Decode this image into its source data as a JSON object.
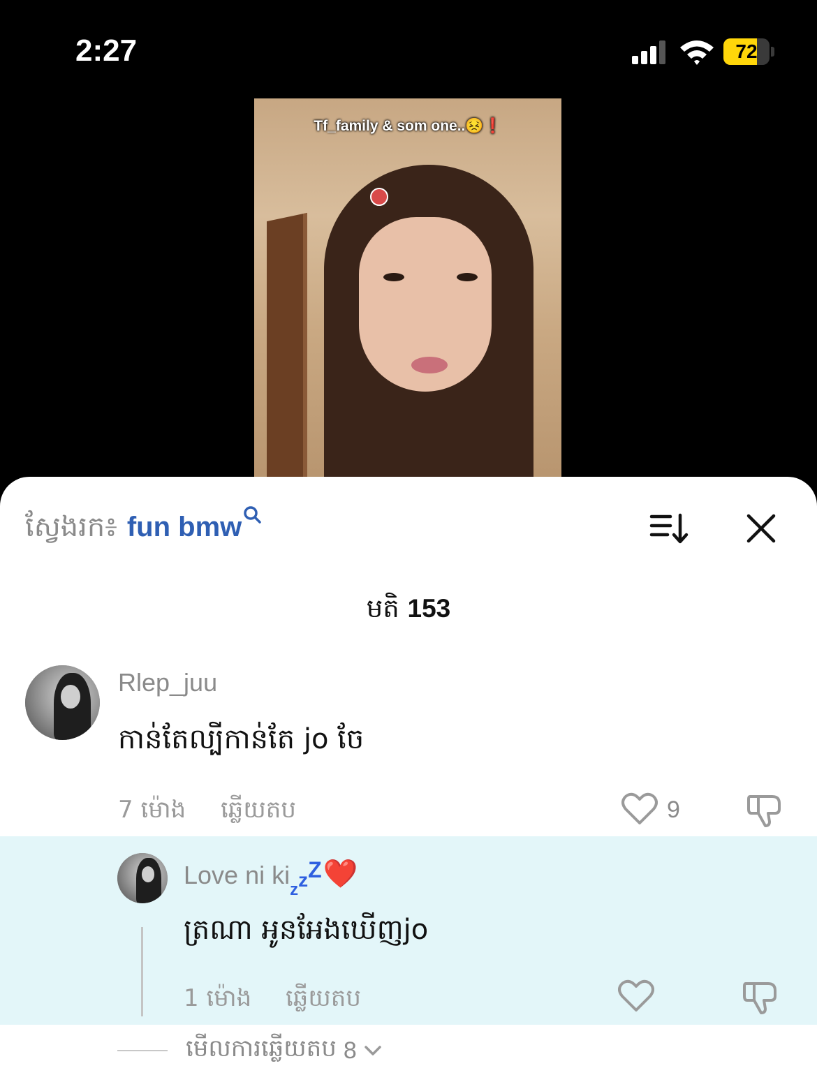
{
  "status_bar": {
    "time": "2:27",
    "battery": "72",
    "battery_level": 0.72
  },
  "video": {
    "caption": "Tf_family & som one..😣❗"
  },
  "comments": {
    "search_prefix": "ស្វែងរក៖",
    "search_term": "fun bmw",
    "count_label": "មតិ",
    "count": "153",
    "items": [
      {
        "username": "Rlep_juu",
        "text": "កាន់តែល្បីកាន់តែ jo ចែ",
        "time": "7 ម៉ោង",
        "reply_label": "ឆ្លើយតប",
        "likes": "9"
      }
    ],
    "reply": {
      "username": "Love ni ki",
      "username_suffix_small": "z",
      "username_suffix_mid": "z",
      "username_suffix_big": "Z",
      "username_emoji": "❤️",
      "text": "ត្រណា អូនអែងឃើញjo",
      "time": "1 ម៉ោង",
      "reply_label": "ឆ្លើយតប"
    },
    "view_replies_label": "មើលការឆ្លើយតប",
    "view_replies_count": "8"
  },
  "colors": {
    "accent": "#2f5fb3",
    "reply_bg": "#e3f6f9",
    "battery": "#ffd60a"
  },
  "icons": [
    "signal-icon",
    "wifi-icon",
    "battery-icon",
    "search-icon",
    "sort-icon",
    "close-icon",
    "heart-icon",
    "dislike-icon",
    "chevron-down-icon"
  ]
}
